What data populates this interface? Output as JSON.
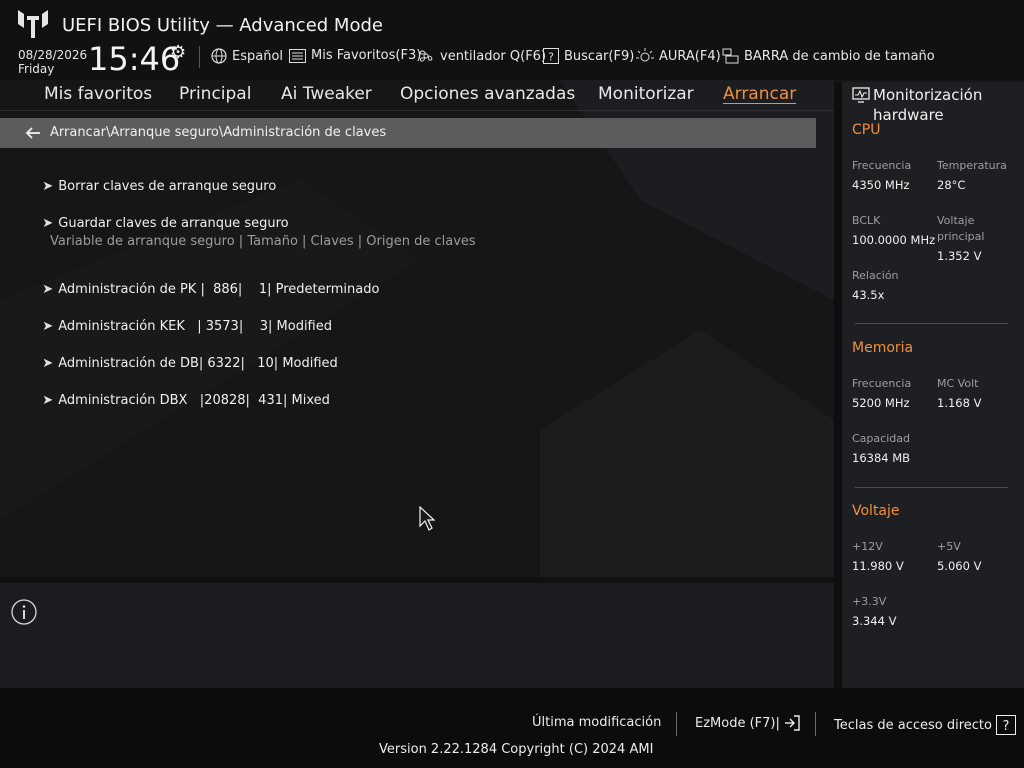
{
  "header": {
    "title": "UEFI BIOS Utility — Advanced Mode",
    "date": "08/28/2026",
    "day": "Friday",
    "time": "15:46",
    "tools": [
      {
        "label": "Español",
        "icon": "globe-icon"
      },
      {
        "label": "Mis Favoritos(F3)",
        "icon": "favorites-list-icon"
      },
      {
        "label": "ventilador Q(F6)",
        "icon": "fan-icon"
      },
      {
        "label": "Buscar(F9)",
        "icon": "help-question-icon"
      },
      {
        "label": "AURA(F4)",
        "icon": "aura-light-icon"
      },
      {
        "label": "BARRA de cambio de tamaño",
        "icon": "resize-bar-icon"
      }
    ]
  },
  "menu": {
    "tabs": [
      "Mis favoritos",
      "Principal",
      "Ai Tweaker",
      "Opciones avanzadas",
      "Monitorizar",
      "Arrancar"
    ],
    "active": "Arrancar",
    "accent_color": "#f0913a"
  },
  "breadcrumb": "Arrancar\\Arranque seguro\\Administración de claves",
  "main": {
    "items": [
      "Borrar claves de arranque seguro",
      "Guardar claves de arranque seguro"
    ],
    "info_header": "Variable de arranque seguro | Tamaño | Claves | Origen de claves",
    "key_items": [
      "Administración de PK |  886|    1| Predeterminado",
      "Administración KEK   | 3573|    3| Modified",
      "Administración de DB| 6322|   10| Modified",
      "Administración DBX   |20828|  431| Mixed"
    ]
  },
  "monitor": {
    "title": "Monitorización hardware",
    "cpu": {
      "title": "CPU",
      "freq_label": "Frecuencia",
      "freq": "4350 MHz",
      "temp_label": "Temperatura",
      "temp": "28°C",
      "bclk_label": "BCLK",
      "bclk": "100.0000 MHz",
      "vcore_label": "Voltaje principal",
      "vcore": "1.352 V",
      "ratio_label": "Relación",
      "ratio": "43.5x"
    },
    "memory": {
      "title": "Memoria",
      "freq_label": "Frecuencia",
      "freq": "5200 MHz",
      "mcvolt_label": "MC Volt",
      "mcvolt": "1.168 V",
      "cap_label": "Capacidad",
      "cap": "16384 MB"
    },
    "voltage": {
      "title": "Voltaje",
      "v12_label": "+12V",
      "v12": "11.980 V",
      "v5_label": "+5V",
      "v5": "5.060 V",
      "v33_label": "+3.3V",
      "v33": "3.344 V"
    }
  },
  "footer": {
    "last_modified": "Última modificación",
    "ezmode": "EzMode (F7)|",
    "hotkeys": "Teclas de acceso directo",
    "version": "Version 2.22.1284 Copyright (C) 2024 AMI"
  }
}
